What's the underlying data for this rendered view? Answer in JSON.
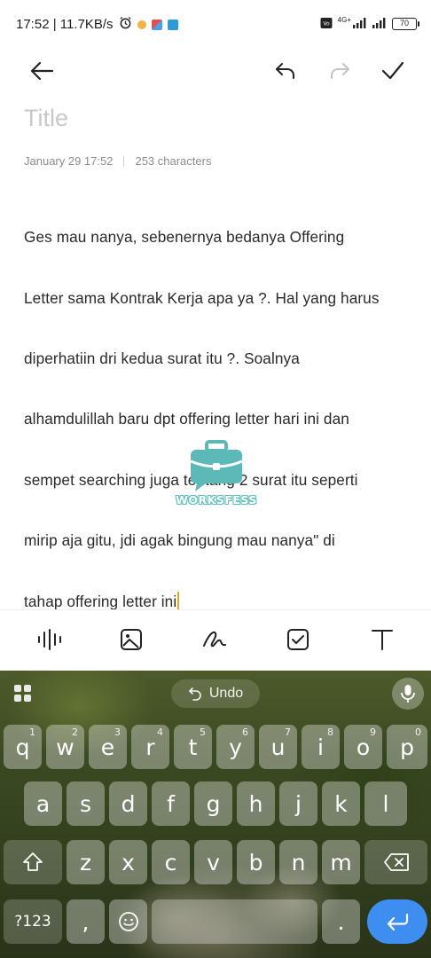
{
  "status_bar": {
    "time_speed": "17:52 | 11.7KB/s",
    "network_label": "4G+",
    "battery": "70"
  },
  "note": {
    "title_placeholder": "Title",
    "date": "January 29 17:52",
    "characters": "253 characters",
    "lines": [
      "Ges mau nanya, sebenernya bedanya Offering",
      "Letter sama Kontrak Kerja apa ya ?. Hal yang harus",
      "diperhatiin dri kedua surat itu ?. Soalnya",
      "alhamdulillah baru dpt offering letter hari ini dan",
      "sempet searching juga tentang 2 surat itu seperti",
      "mirip aja gitu, jdi agak bingung mau nanya\" di",
      "tahap offering letter ini"
    ]
  },
  "logo": {
    "text": "WORKSFESS",
    "color": "#5db8b8"
  },
  "keyboard": {
    "undo_label": "Undo",
    "row1": [
      {
        "key": "q",
        "hint": "1"
      },
      {
        "key": "w",
        "hint": "2"
      },
      {
        "key": "e",
        "hint": "3"
      },
      {
        "key": "r",
        "hint": "4"
      },
      {
        "key": "t",
        "hint": "5"
      },
      {
        "key": "y",
        "hint": "6"
      },
      {
        "key": "u",
        "hint": "7"
      },
      {
        "key": "i",
        "hint": "8"
      },
      {
        "key": "o",
        "hint": "9"
      },
      {
        "key": "p",
        "hint": "0"
      }
    ],
    "row2": [
      "a",
      "s",
      "d",
      "f",
      "g",
      "h",
      "j",
      "k",
      "l"
    ],
    "row3": [
      "z",
      "x",
      "c",
      "v",
      "b",
      "n",
      "m"
    ],
    "symbols_label": "?123",
    "comma": ",",
    "period": ".",
    "enter_color": "#3d8ef0"
  },
  "colors": {
    "title_placeholder": "#c8c8c8",
    "caret": "#e0a81f",
    "text": "#2a2a2a"
  }
}
